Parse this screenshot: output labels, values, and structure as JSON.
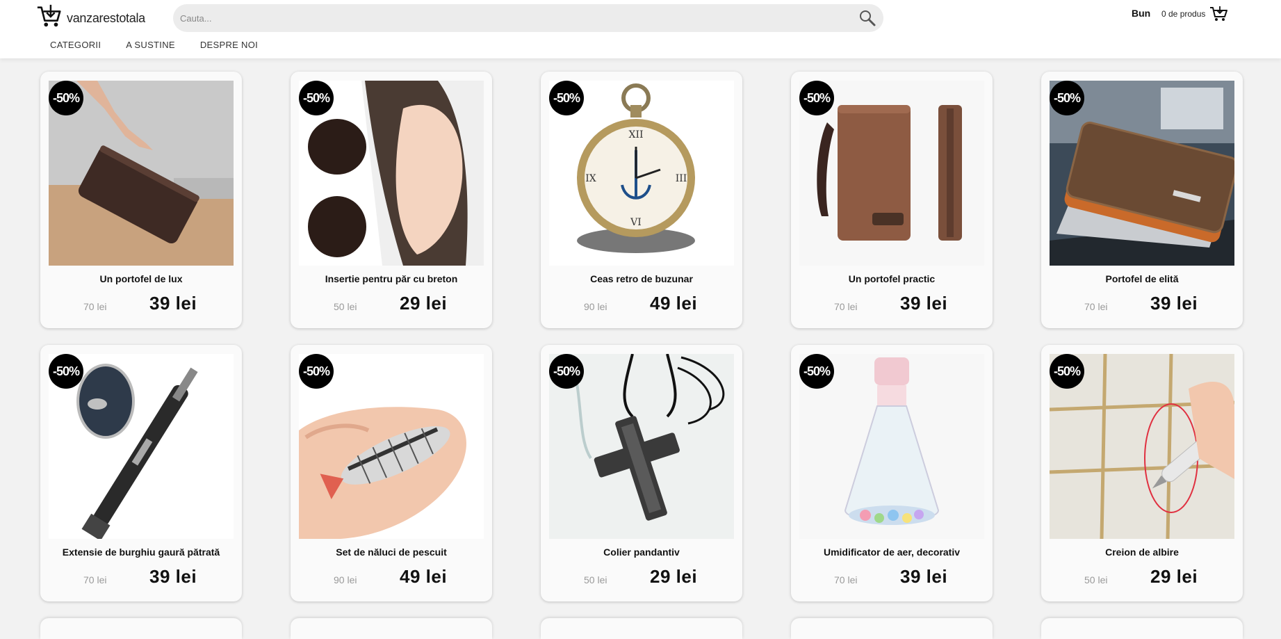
{
  "header": {
    "logo_text": "vanzarestotala",
    "search_placeholder": "Cauta...",
    "account_label": "Bun",
    "cart_label": "0 de produs"
  },
  "nav": [
    {
      "label": "CATEGORII"
    },
    {
      "label": "A SUSTINE"
    },
    {
      "label": "DESPRE NOI"
    }
  ],
  "products": [
    {
      "badge": "-50%",
      "title": "Un portofel de lux",
      "old_price": "70 lei",
      "new_price": "39 lei",
      "image": "brown-clutch-wallet"
    },
    {
      "badge": "-50%",
      "title": "Insertie pentru păr cu breton",
      "old_price": "50 lei",
      "new_price": "29 lei",
      "image": "hair-bangs-insert"
    },
    {
      "badge": "-50%",
      "title": "Ceas retro de buzunar",
      "old_price": "90 lei",
      "new_price": "49 lei",
      "image": "pocket-watch"
    },
    {
      "badge": "-50%",
      "title": "Un portofel practic",
      "old_price": "70 lei",
      "new_price": "39 lei",
      "image": "long-wallet"
    },
    {
      "badge": "-50%",
      "title": "Portofel de elită",
      "old_price": "70 lei",
      "new_price": "39 lei",
      "image": "bifold-wallet"
    },
    {
      "badge": "-50%",
      "title": "Extensie de burghiu gaură pătrată",
      "old_price": "70 lei",
      "new_price": "39 lei",
      "image": "square-hole-drill-bit"
    },
    {
      "badge": "-50%",
      "title": "Set de năluci de pescuit",
      "old_price": "90 lei",
      "new_price": "49 lei",
      "image": "fishing-lure"
    },
    {
      "badge": "-50%",
      "title": "Colier pandantiv",
      "old_price": "50 lei",
      "new_price": "29 lei",
      "image": "cross-pendant"
    },
    {
      "badge": "-50%",
      "title": "Umidificator de aer, decorativ",
      "old_price": "70 lei",
      "new_price": "39 lei",
      "image": "humidifier-bottle"
    },
    {
      "badge": "-50%",
      "title": "Creion de albire",
      "old_price": "50 lei",
      "new_price": "29 lei",
      "image": "grout-pen"
    }
  ]
}
